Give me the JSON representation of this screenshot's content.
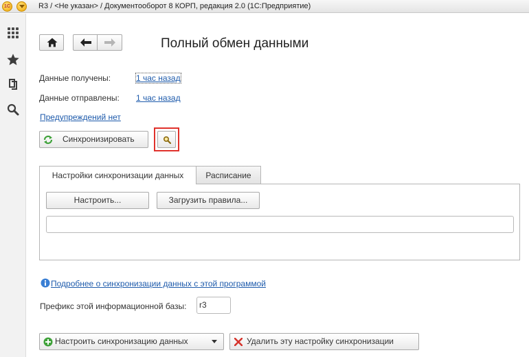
{
  "window": {
    "title": "R3 / <Не указан> / Документооборот 8 КОРП, редакция 2.0  (1С:Предприятие)",
    "logo_text": "1С"
  },
  "sidebar": {
    "items": [
      {
        "name": "apps-grid-icon"
      },
      {
        "name": "favorites-star-icon"
      },
      {
        "name": "history-icon"
      },
      {
        "name": "search-icon"
      }
    ]
  },
  "toolbar": {
    "home_icon": "home-icon",
    "back_icon": "arrow-left-icon",
    "forward_icon": "arrow-right-icon"
  },
  "page": {
    "title": "Полный обмен данными"
  },
  "status": {
    "received_label": "Данные получены:",
    "received_value": "1 час назад",
    "sent_label": "Данные отправлены:",
    "sent_value": "1 час назад",
    "warnings_link": "Предупреждений нет"
  },
  "actions": {
    "sync_label": "Синхронизировать",
    "sync_icon": "sync-icon",
    "find_icon": "magnifier-icon"
  },
  "tabs": [
    {
      "label": "Настройки синхронизации данных",
      "active": true
    },
    {
      "label": "Расписание",
      "active": false
    }
  ],
  "tab_panel": {
    "configure_label": "Настроить...",
    "load_rules_label": "Загрузить правила...",
    "info_field_value": ""
  },
  "info": {
    "more_link": "Подробнее о синхронизации данных с этой программой",
    "prefix_label": "Префикс этой информационной базы:",
    "prefix_value": "r3"
  },
  "bottom": {
    "setup_sync_label": "Настроить синхронизацию данных",
    "delete_setting_label": "Удалить эту настройку синхронизации"
  },
  "colors": {
    "link": "#1d5aab",
    "highlight_frame": "#e0302a",
    "green_icon": "#3fa23a",
    "delete_icon": "#d6342c"
  }
}
